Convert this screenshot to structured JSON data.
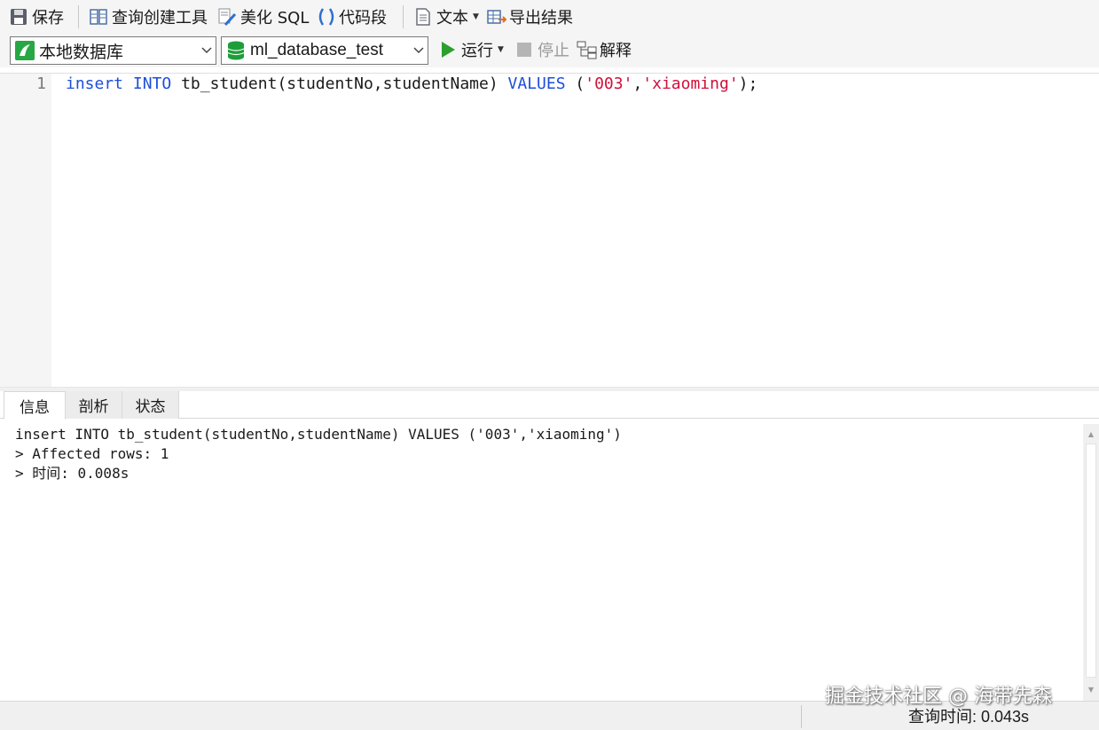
{
  "toolbar": {
    "save": "保存",
    "query_builder": "查询创建工具",
    "beautify_sql": "美化 SQL",
    "code_snippet": "代码段",
    "text": "文本",
    "export_results": "导出结果"
  },
  "toolbar2": {
    "connection": "本地数据库",
    "database": "ml_database_test",
    "run": "运行",
    "stop": "停止",
    "explain": "解释"
  },
  "editor": {
    "line_number": "1",
    "tokens": {
      "t1": "insert",
      "t2": " ",
      "t3": "INTO",
      "t4": " tb_student(studentNo,studentName) ",
      "t5": "VALUES",
      "t6": " (",
      "t7": "'003'",
      "t8": ",",
      "t9": "'xiaoming'",
      "t10": ");"
    }
  },
  "tabs": {
    "info": "信息",
    "profile": "剖析",
    "status": "状态"
  },
  "results": {
    "line1": "insert INTO tb_student(studentNo,studentName) VALUES ('003','xiaoming')",
    "line2": "> Affected rows: 1",
    "line3": "> 时间: 0.008s"
  },
  "statusbar": {
    "query_time": "查询时间: 0.043s"
  },
  "watermark": "掘金技术社区 @ 海带先森",
  "colors": {
    "keyword": "#1d4fd8",
    "string": "#d0103a",
    "run_green": "#2ca02c",
    "db_green": "#1e9e3a"
  },
  "icons": {
    "save": "floppy-disk-icon",
    "query_builder": "query-builder-icon",
    "beautify": "brush-icon",
    "code_snippet": "parentheses-icon",
    "text": "document-icon",
    "export": "export-table-icon",
    "connection": "connection-icon",
    "database": "database-icon",
    "run": "play-icon",
    "stop": "stop-icon",
    "explain": "explain-icon"
  }
}
